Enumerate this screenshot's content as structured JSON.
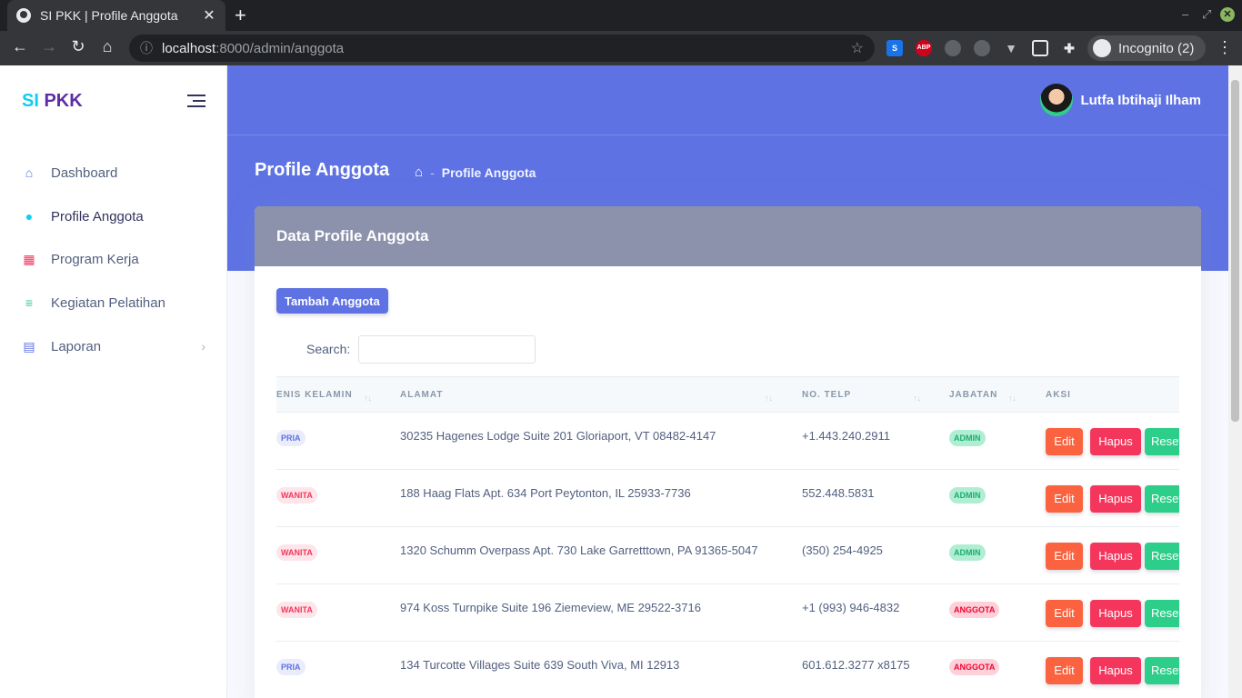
{
  "browser": {
    "tab_title": "SI PKK | Profile Anggota",
    "url_host": "localhost",
    "url_rest": ":8000/admin/anggota",
    "incognito_label": "Incognito (2)",
    "extensions": [
      "S",
      "ABP",
      "",
      "2",
      "",
      "",
      ""
    ]
  },
  "sidebar": {
    "brand_si": "SI",
    "brand_pkk": "PKK",
    "items": [
      {
        "label": "Dashboard",
        "icon": "shop-icon",
        "color": "#5e72e4"
      },
      {
        "label": "Profile Anggota",
        "icon": "user-icon",
        "color": "#11cdef"
      },
      {
        "label": "Program Kerja",
        "icon": "calendar-icon",
        "color": "#f5365c"
      },
      {
        "label": "Kegiatan Pelatihan",
        "icon": "align-left-icon",
        "color": "#2dce89"
      },
      {
        "label": "Laporan",
        "icon": "document-icon",
        "color": "#5e72e4"
      }
    ]
  },
  "header": {
    "user_name": "Lutfa Ibtihaji Ilham",
    "page_title": "Profile Anggota",
    "breadcrumb_current": "Profile Anggota",
    "breadcrumb_sep": "-"
  },
  "card": {
    "title": "Data Profile Anggota",
    "add_button": "Tambah Anggota",
    "search_label": "Search:",
    "search_value": ""
  },
  "table": {
    "columns": [
      "ENIS KELAMIN",
      "ALAMAT",
      "NO. TELP",
      "JABATAN",
      "AKSI"
    ],
    "rows": [
      {
        "gender": "PRIA",
        "address": "30235 Hagenes Lodge Suite 201 Gloriaport, VT 08482-4147",
        "phone": "+1.443.240.2911",
        "role": "ADMIN"
      },
      {
        "gender": "WANITA",
        "address": "188 Haag Flats Apt. 634 Port Peytonton, IL 25933-7736",
        "phone": "552.448.5831",
        "role": "ADMIN"
      },
      {
        "gender": "WANITA",
        "address": "1320 Schumm Overpass Apt. 730 Lake Garretttown, PA 91365-5047",
        "phone": "(350) 254-4925",
        "role": "ADMIN"
      },
      {
        "gender": "WANITA",
        "address": "974 Koss Turnpike Suite 196 Ziemeview, ME 29522-3716",
        "phone": "+1 (993) 946-4832",
        "role": "ANGGOTA"
      },
      {
        "gender": "PRIA",
        "address": "134 Turcotte Villages Suite 639 South Viva, MI 12913",
        "phone": "601.612.3277 x8175",
        "role": "ANGGOTA"
      }
    ],
    "actions": {
      "edit": "Edit",
      "hapus": "Hapus",
      "reset": "Reset"
    }
  }
}
